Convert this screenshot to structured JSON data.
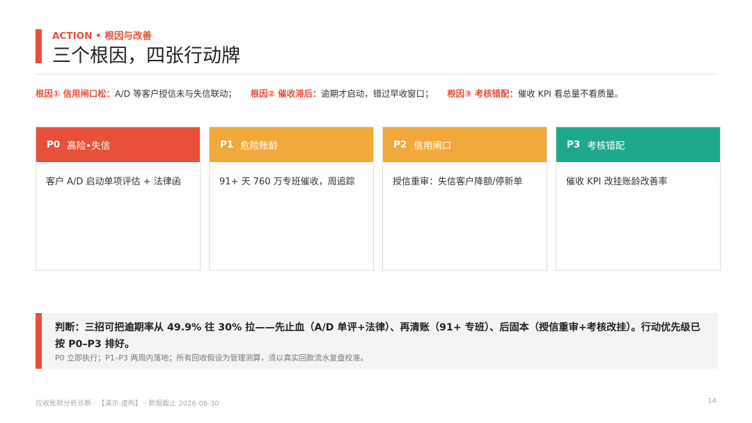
{
  "header": {
    "kicker": "ACTION • 根因与改善",
    "title": "三个根因，四张行动牌"
  },
  "causes": [
    {
      "label": "根因① 信用闸口松：",
      "text": "A/D 等客户授信未与失信联动；"
    },
    {
      "label": "根因② 催收滞后：",
      "text": "逾期才启动，错过早收窗口；"
    },
    {
      "label": "根因③ 考核错配：",
      "text": "催收 KPI 看总量不看质量。"
    }
  ],
  "cards": [
    {
      "code": "P0",
      "title": "高险•失信",
      "body": "客户 A/D 启动单项评估 + 法律函",
      "color": "#e8503a"
    },
    {
      "code": "P1",
      "title": "危险账龄",
      "body": "91+ 天 760 万专班催收，周追踪",
      "color": "#f2a93b"
    },
    {
      "code": "P2",
      "title": "信用闸口",
      "body": "授信重审：失信客户降额/停新单",
      "color": "#f2a93b"
    },
    {
      "code": "P3",
      "title": "考核错配",
      "body": "催收 KPI 改挂账龄改善率",
      "color": "#1fa98c"
    }
  ],
  "verdict": {
    "main": "判断：三招可把逾期率从 49.9% 往 30% 拉——先止血（A/D 单评+法律）、再清账（91+ 专班）、后固本（授信重审+考核改挂）。行动优先级已按 P0–P3 排好。",
    "note": "P0 立即执行；P1–P3 两周内落地；所有回收假设为管理测算，须以真实回款流水复盘校准。"
  },
  "footer": {
    "left": "应收账款分析诊断 · 【演示·虚构】 · 数据截止 2026-06-30",
    "page_number": "14"
  },
  "colors": {
    "accent": "#e8503a",
    "amber": "#f2a93b",
    "teal": "#1fa98c"
  }
}
